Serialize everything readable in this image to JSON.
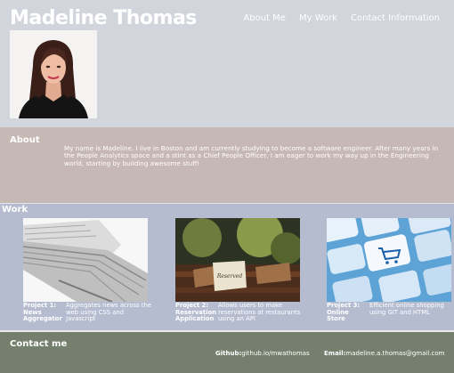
{
  "header": {
    "site_title": "Madeline Thomas",
    "nav": [
      {
        "label": "About Me"
      },
      {
        "label": "My Work"
      },
      {
        "label": "Contact Information"
      }
    ]
  },
  "about": {
    "heading": "About",
    "text": "My name is Madeline. I live in Boston and am currently studying to become a software engineer. After many years in the People Analytics space and a stint as a Chief People Officer, I am eager to work my way up in the Engineering world, starting by building awesome stuff!"
  },
  "work": {
    "heading": "Work",
    "projects": [
      {
        "title": "Project 1: News Aggregator",
        "description": "Aggregates news across the web using CSS and Javascript"
      },
      {
        "title": "Project 2: Reservation Application",
        "description": "Allows users to make reservations at restaurants using an API"
      },
      {
        "title": "Project 3: Online Store",
        "description": "Efficient online shopping using GIT and HTML"
      }
    ]
  },
  "contact": {
    "heading": "Contact me",
    "github_label": "Github:",
    "github_value": "github.io/mwathomas",
    "email_label": "Email:",
    "email_value": "madeline.a.thomas@gmail.com"
  }
}
